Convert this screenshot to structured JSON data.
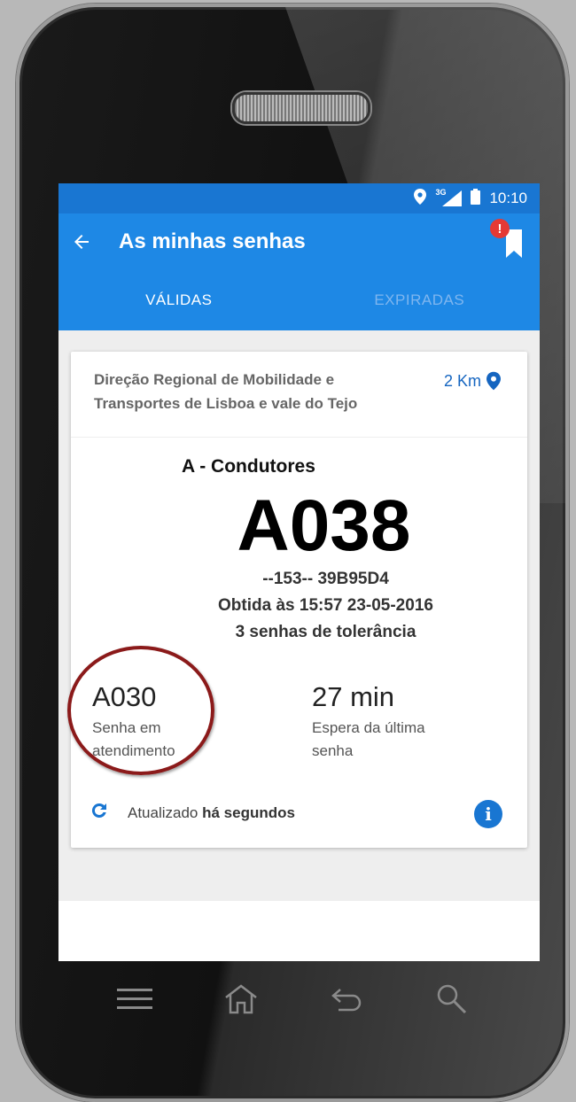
{
  "status_bar": {
    "network": "3G",
    "time": "10:10"
  },
  "app_bar": {
    "title": "As minhas senhas",
    "badge": "!"
  },
  "tabs": [
    {
      "label": "VÁLIDAS"
    },
    {
      "label": "EXPIRADAS"
    }
  ],
  "card": {
    "office_name": "Direção Regional de Mobilidade e Transportes de Lisboa e vale do Tejo",
    "distance": "2 Km",
    "queue_name": "A - Condutores",
    "ticket_number": "A038",
    "ticket_code": "--153-- 39B95D4",
    "obtained": "Obtida às 15:57 23-05-2016",
    "tolerance": "3 senhas de tolerância",
    "current_ticket": "A030",
    "current_ticket_label": "Senha em atendimento",
    "wait_time": "27 min",
    "wait_time_label": "Espera da última senha",
    "refresh_prefix": "Atualizado",
    "refresh_time": "há segundos"
  },
  "colors": {
    "primary": "#1e88e5",
    "status_bar": "#1976d2",
    "accent": "#1565c0",
    "badge": "#e53935",
    "annotation_circle": "#8b1a1a"
  }
}
